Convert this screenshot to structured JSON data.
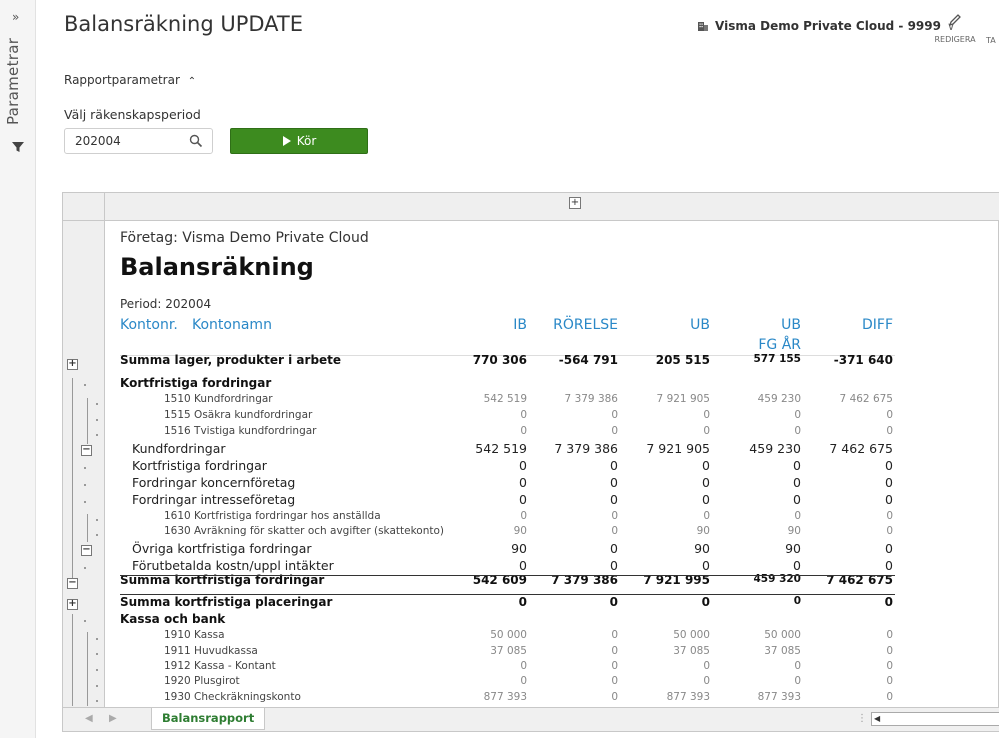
{
  "sidebar": {
    "expand_glyph": "»",
    "label": "Parametrar",
    "filter_icon": "funnel-icon"
  },
  "header": {
    "title": "Balansräkning UPDATE",
    "company": "Visma Demo Private Cloud - 9999",
    "edit_label": "REDIGERA",
    "ta_label": "TA"
  },
  "params": {
    "toggle_label": "Rapportparametrar",
    "period_label": "Välj räkenskapsperiod",
    "period_value": "202004",
    "run_label": "Kör"
  },
  "sheet": {
    "tab_label": "Balansrapport",
    "expand_glyph": "+"
  },
  "report": {
    "company_line": "Företag: Visma Demo Private Cloud",
    "title": "Balansräkning",
    "period_line": "Period: 202004",
    "headers": {
      "kontonr": "Kontonr.",
      "kontonamn": "Kontonamn",
      "ib": "IB",
      "rorelse": "RÖRELSE",
      "ub": "UB",
      "ub_fg": "UB",
      "ub_fg2": "FG ÅR",
      "diff": "DIFF"
    },
    "rows": [
      {
        "label": "Summa lager, produkter i arbete",
        "style": "bold",
        "values": [
          "770 306",
          "-564 791",
          "205 515",
          "577 155",
          "-371 640"
        ]
      },
      {
        "label": "Kortfristiga fordringar",
        "style": "bold",
        "values": [
          "",
          "",
          "",
          "",
          ""
        ]
      },
      {
        "label": "1510 Kundfordringar",
        "style": "small",
        "values": [
          "542 519",
          "7 379 386",
          "7 921 905",
          "459 230",
          "7 462 675"
        ]
      },
      {
        "label": "1515 Osäkra kundfordringar",
        "style": "small",
        "values": [
          "0",
          "0",
          "0",
          "0",
          "0"
        ]
      },
      {
        "label": "1516 Tvistiga kundfordringar",
        "style": "small",
        "values": [
          "0",
          "0",
          "0",
          "0",
          "0"
        ]
      },
      {
        "label": "Kundfordringar",
        "style": "norm",
        "values": [
          "542 519",
          "7 379 386",
          "7 921 905",
          "459 230",
          "7 462 675"
        ]
      },
      {
        "label": "Kortfristiga fordringar",
        "style": "norm",
        "values": [
          "0",
          "0",
          "0",
          "0",
          "0"
        ]
      },
      {
        "label": "Fordringar koncernföretag",
        "style": "norm",
        "values": [
          "0",
          "0",
          "0",
          "0",
          "0"
        ]
      },
      {
        "label": "Fordringar intresseföretag",
        "style": "norm",
        "values": [
          "0",
          "0",
          "0",
          "0",
          "0"
        ]
      },
      {
        "label": "1610 Kortfristiga fordringar hos anställda",
        "style": "small",
        "values": [
          "0",
          "0",
          "0",
          "0",
          "0"
        ]
      },
      {
        "label": "1630 Avräkning för skatter och avgifter (skattekonto)",
        "style": "small",
        "values": [
          "90",
          "0",
          "90",
          "90",
          "0"
        ]
      },
      {
        "label": "Övriga kortfristiga fordringar",
        "style": "norm",
        "values": [
          "90",
          "0",
          "90",
          "90",
          "0"
        ]
      },
      {
        "label": "Förutbetalda kostn/uppl intäkter",
        "style": "norm",
        "values": [
          "0",
          "0",
          "0",
          "0",
          "0"
        ]
      },
      {
        "label": "Summa kortfristiga fordringar",
        "style": "bold",
        "values": [
          "542 609",
          "7 379 386",
          "7 921 995",
          "459 320",
          "7 462 675"
        ]
      },
      {
        "label": "Summa kortfristiga placeringar",
        "style": "bold",
        "values": [
          "0",
          "0",
          "0",
          "0",
          "0"
        ]
      },
      {
        "label": "Kassa och bank",
        "style": "bold",
        "values": [
          "",
          "",
          "",
          "",
          ""
        ]
      },
      {
        "label": "1910 Kassa",
        "style": "small",
        "values": [
          "50 000",
          "0",
          "50 000",
          "50 000",
          "0"
        ]
      },
      {
        "label": "1911 Huvudkassa",
        "style": "small",
        "values": [
          "37 085",
          "0",
          "37 085",
          "37 085",
          "0"
        ]
      },
      {
        "label": "1912 Kassa - Kontant",
        "style": "small",
        "values": [
          "0",
          "0",
          "0",
          "0",
          "0"
        ]
      },
      {
        "label": "1920 Plusgirot",
        "style": "small",
        "values": [
          "0",
          "0",
          "0",
          "0",
          "0"
        ]
      },
      {
        "label": "1930 Checkräkningskonto",
        "style": "small",
        "values": [
          "877 393",
          "0",
          "877 393",
          "877 393",
          "0"
        ]
      }
    ]
  }
}
